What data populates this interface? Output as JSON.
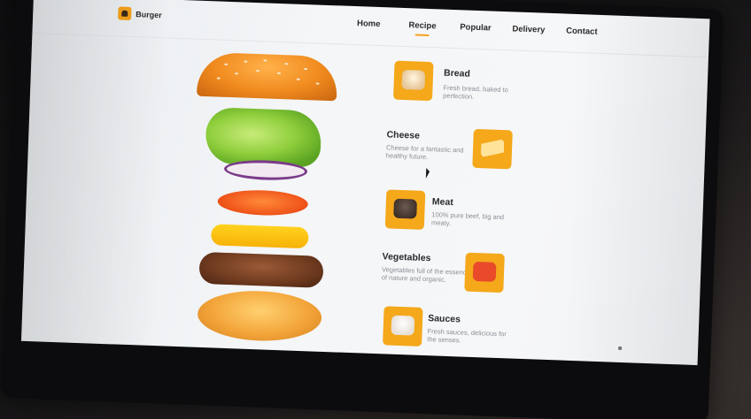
{
  "header": {
    "logo_text": "Burger",
    "nav": [
      {
        "label": "Home",
        "active": false
      },
      {
        "label": "Recipe",
        "active": true
      },
      {
        "label": "Popular",
        "active": false
      },
      {
        "label": "Delivery",
        "active": false
      },
      {
        "label": "Contact",
        "active": false
      }
    ]
  },
  "ingredients": [
    {
      "title": "Bread",
      "desc": "Fresh bread, baked to perfection.",
      "icon": "bread-icon"
    },
    {
      "title": "Cheese",
      "desc": "Cheese for a fantastic and healthy future.",
      "icon": "cheese-icon"
    },
    {
      "title": "Meat",
      "desc": "100% pure beef, big and meaty.",
      "icon": "meat-icon"
    },
    {
      "title": "Vegetables",
      "desc": "Vegetables full of the essence of nature and organic.",
      "icon": "tomato-icon"
    },
    {
      "title": "Sauces",
      "desc": "Fresh sauces, delicious for the senses.",
      "icon": "sauce-icon"
    }
  ],
  "colors": {
    "accent": "#f4a21a",
    "screen_bg": "#f4f6f8",
    "text": "#2a2a2a",
    "muted": "#8a8f96"
  }
}
